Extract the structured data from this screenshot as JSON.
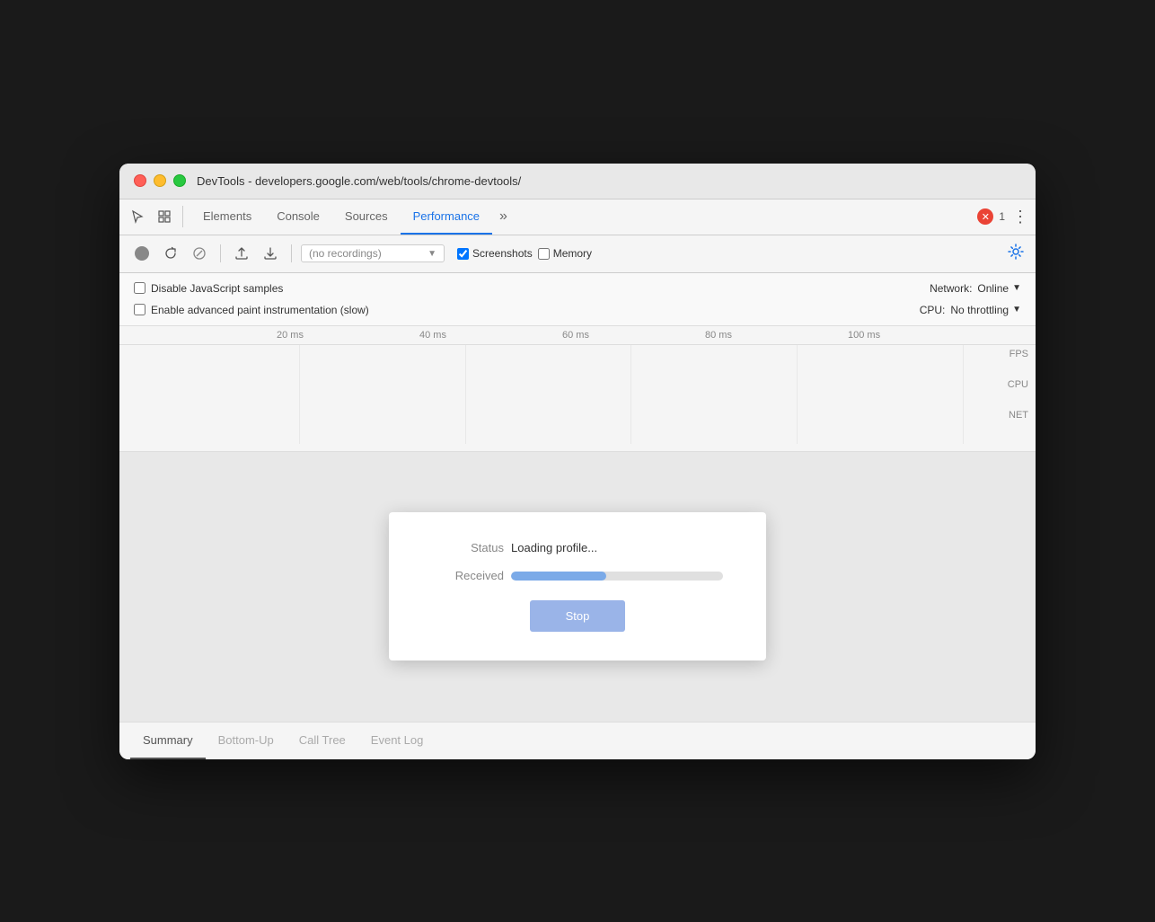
{
  "window": {
    "title": "DevTools - developers.google.com/web/tools/chrome-devtools/"
  },
  "tabs": {
    "list": [
      {
        "id": "elements",
        "label": "Elements",
        "active": false
      },
      {
        "id": "console",
        "label": "Console",
        "active": false
      },
      {
        "id": "sources",
        "label": "Sources",
        "active": false
      },
      {
        "id": "performance",
        "label": "Performance",
        "active": true
      }
    ],
    "more_label": "»",
    "error_count": "1",
    "menu_label": "⋮"
  },
  "toolbar": {
    "recordings_placeholder": "(no recordings)",
    "screenshots_label": "Screenshots",
    "memory_label": "Memory"
  },
  "settings": {
    "disable_js_label": "Disable JavaScript samples",
    "enable_paint_label": "Enable advanced paint instrumentation (slow)",
    "network_label": "Network:",
    "network_value": "Online",
    "cpu_label": "CPU:",
    "cpu_value": "No throttling"
  },
  "timeline": {
    "marks": [
      "20 ms",
      "40 ms",
      "60 ms",
      "80 ms",
      "100 ms"
    ],
    "fps_label": "FPS",
    "cpu_label": "CPU",
    "net_label": "NET"
  },
  "loading_dialog": {
    "status_label": "Status",
    "status_value": "Loading profile...",
    "received_label": "Received",
    "progress_percent": 45,
    "stop_button_label": "Stop"
  },
  "bottom_tabs": {
    "list": [
      {
        "id": "summary",
        "label": "Summary",
        "active": true
      },
      {
        "id": "bottom-up",
        "label": "Bottom-Up",
        "active": false
      },
      {
        "id": "call-tree",
        "label": "Call Tree",
        "active": false
      },
      {
        "id": "event-log",
        "label": "Event Log",
        "active": false
      }
    ]
  }
}
